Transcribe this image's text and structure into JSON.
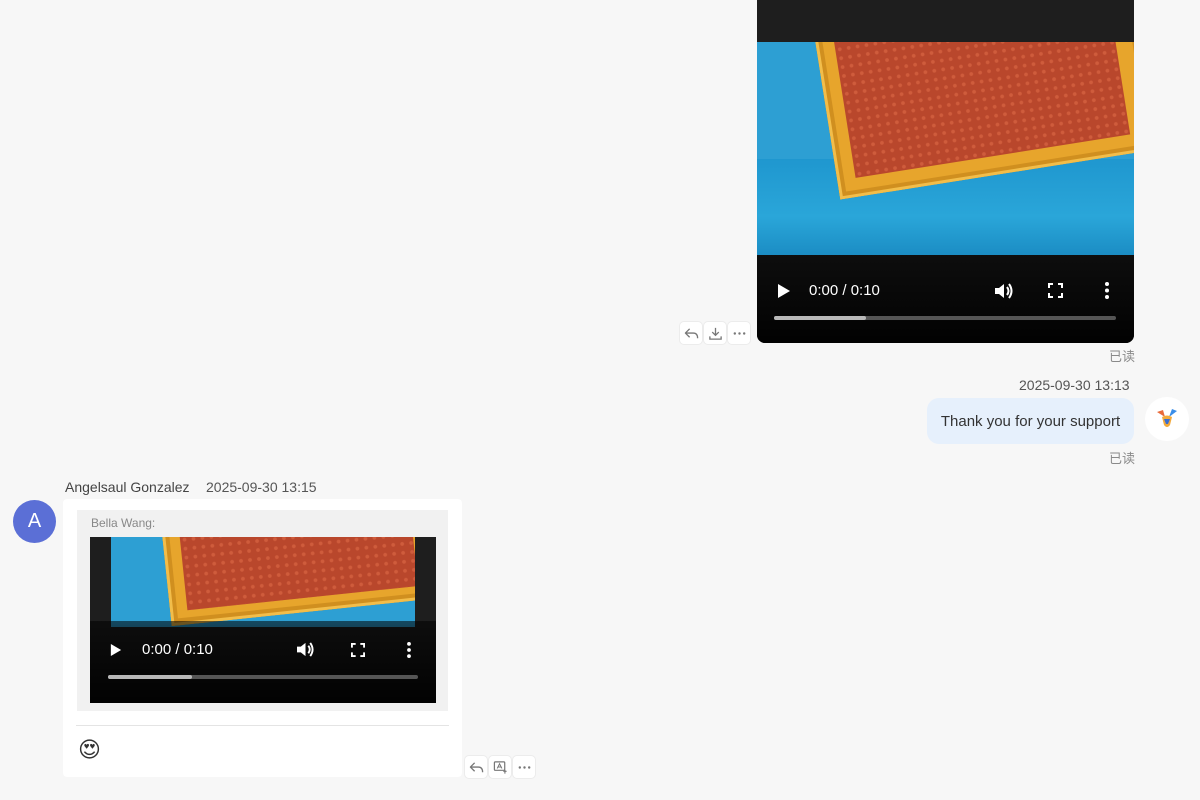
{
  "messages": {
    "outgoing_video": {
      "time_display": "0:00 / 0:10",
      "progress_buffered": 0.27,
      "read_status": "已读",
      "actions": [
        "reply-icon",
        "download-icon",
        "more-icon"
      ]
    },
    "outgoing_text": {
      "timestamp": "2025-09-30 13:13",
      "text": "Thank you for your support",
      "read_status": "已读"
    },
    "incoming": {
      "sender_name": "Angelsaul Gonzalez",
      "timestamp": "2025-09-30 13:15",
      "avatar_letter": "A",
      "avatar_color": "#5b6fd6",
      "quote_author": "Bella Wang:",
      "quoted_video": {
        "time_display": "0:00 / 0:10",
        "progress_buffered": 0.27
      },
      "emoji": "😍",
      "actions": [
        "reply-icon",
        "translate-icon",
        "more-icon"
      ]
    }
  },
  "colors": {
    "page_bg": "#f7f7f7",
    "outgoing_bubble": "#e6f0fc",
    "accent_avatar": "#5b6fd6"
  }
}
